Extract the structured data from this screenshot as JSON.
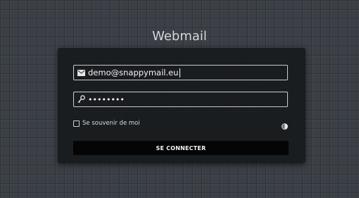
{
  "app": {
    "title": "Webmail"
  },
  "login_form": {
    "email": {
      "value": "demo@snappymail.eu",
      "icon": "envelope-icon"
    },
    "password": {
      "value": "••••••••",
      "icon": "key-icon"
    },
    "remember_me": {
      "label": "Se souvenir de moi",
      "checked": false
    },
    "language_icon": "language-globe-icon",
    "submit_label": "SE CONNECTER"
  },
  "colors": {
    "background": "#3b3f46",
    "card": "#16181b",
    "field_border": "#c9cbcf",
    "button": "#050505",
    "text": "#f2f2f2"
  }
}
